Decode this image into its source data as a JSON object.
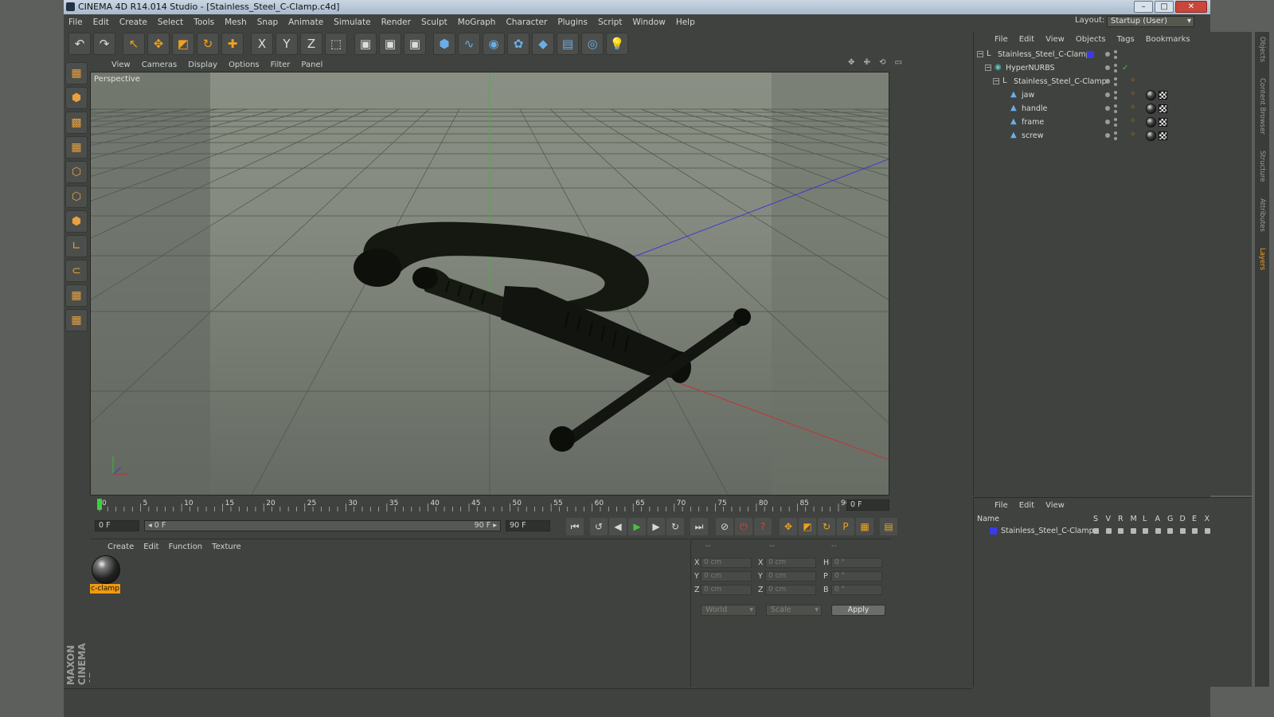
{
  "window": {
    "title": "CINEMA 4D R14.014 Studio - [Stainless_Steel_C-Clamp.c4d]",
    "min": "–",
    "max": "□",
    "close": "✕"
  },
  "menubar": [
    "File",
    "Edit",
    "Create",
    "Select",
    "Tools",
    "Mesh",
    "Snap",
    "Animate",
    "Simulate",
    "Render",
    "Sculpt",
    "MoGraph",
    "Character",
    "Plugins",
    "Script",
    "Window",
    "Help"
  ],
  "layout": {
    "label": "Layout:",
    "value": "Startup (User)"
  },
  "toolbar": [
    {
      "name": "undo-icon",
      "glyph": "↶"
    },
    {
      "name": "redo-icon",
      "glyph": "↷"
    },
    {
      "name": "live-select-icon",
      "glyph": "↖"
    },
    {
      "name": "move-icon",
      "glyph": "✥"
    },
    {
      "name": "scale-icon",
      "glyph": "◩"
    },
    {
      "name": "rotate-icon",
      "glyph": "↻"
    },
    {
      "name": "add-icon",
      "glyph": "✚"
    },
    {
      "name": "x-axis-icon",
      "glyph": "X"
    },
    {
      "name": "y-axis-icon",
      "glyph": "Y"
    },
    {
      "name": "z-axis-icon",
      "glyph": "Z"
    },
    {
      "name": "coordinate-system-icon",
      "glyph": "⬚"
    },
    {
      "name": "render-view-icon",
      "glyph": "▣"
    },
    {
      "name": "render-picture-viewer-icon",
      "glyph": "▣"
    },
    {
      "name": "render-settings-icon",
      "glyph": "▣"
    },
    {
      "name": "cube-icon",
      "glyph": "⬢"
    },
    {
      "name": "spline-icon",
      "glyph": "∿"
    },
    {
      "name": "nurbs-icon",
      "glyph": "◉"
    },
    {
      "name": "array-icon",
      "glyph": "✿"
    },
    {
      "name": "deformer-icon",
      "glyph": "◆"
    },
    {
      "name": "scene-floor-icon",
      "glyph": "▤"
    },
    {
      "name": "camera-icon",
      "glyph": "◎"
    },
    {
      "name": "light-icon",
      "glyph": "💡"
    }
  ],
  "lefttools": [
    {
      "name": "make-editable-icon",
      "glyph": "▦"
    },
    {
      "name": "model-mode-icon",
      "glyph": "⬢"
    },
    {
      "name": "texture-mode-icon",
      "glyph": "▩"
    },
    {
      "name": "workplane-mode-icon",
      "glyph": "▦"
    },
    {
      "name": "points-mode-icon",
      "glyph": "⬡"
    },
    {
      "name": "edges-mode-icon",
      "glyph": "⬡"
    },
    {
      "name": "polygons-mode-icon",
      "glyph": "⬢"
    },
    {
      "name": "axis-mode-icon",
      "glyph": "∟"
    },
    {
      "name": "snap-icon",
      "glyph": "⊂"
    },
    {
      "name": "workplane-icon",
      "glyph": "▦"
    },
    {
      "name": "locked-workplane-icon",
      "glyph": "▦"
    }
  ],
  "brand": "MAXON CINEMA 4D",
  "viewport": {
    "menu": [
      "View",
      "Cameras",
      "Display",
      "Options",
      "Filter",
      "Panel"
    ],
    "label": "Perspective",
    "icons": "✥ ✙ ⟲ ▭"
  },
  "timeline": {
    "ticks": [
      "0",
      "5",
      "10",
      "15",
      "20",
      "25",
      "30",
      "35",
      "40",
      "45",
      "50",
      "55",
      "60",
      "65",
      "70",
      "75",
      "80",
      "85",
      "90"
    ],
    "current_frame": "0 F"
  },
  "playbar": {
    "start": "0 F",
    "range_start": "◂ 0 F",
    "range_end": "90 F ▸",
    "end": "90 F",
    "buttons": [
      {
        "name": "go-to-start-icon",
        "glyph": "⏮",
        "cls": ""
      },
      {
        "name": "previous-key-icon",
        "glyph": "↺",
        "cls": ""
      },
      {
        "name": "previous-frame-icon",
        "glyph": "◀",
        "cls": ""
      },
      {
        "name": "play-forward-icon",
        "glyph": "▶",
        "cls": "green"
      },
      {
        "name": "next-frame-icon",
        "glyph": "▶",
        "cls": ""
      },
      {
        "name": "next-key-icon",
        "glyph": "↻",
        "cls": ""
      },
      {
        "name": "go-to-end-icon",
        "glyph": "⏭",
        "cls": ""
      },
      {
        "name": "record-active-objects-icon",
        "glyph": "⊘",
        "cls": ""
      },
      {
        "name": "autokeying-icon",
        "glyph": "⏻",
        "cls": "red"
      },
      {
        "name": "keyframe-selection-icon",
        "glyph": "?",
        "cls": "red"
      },
      {
        "name": "position-key-icon",
        "glyph": "✥",
        "cls": "org"
      },
      {
        "name": "scale-key-icon",
        "glyph": "◩",
        "cls": "org"
      },
      {
        "name": "rotation-key-icon",
        "glyph": "↻",
        "cls": "org"
      },
      {
        "name": "parameter-key-icon",
        "glyph": "P",
        "cls": "org"
      },
      {
        "name": "point-level-key-icon",
        "glyph": "▦",
        "cls": "org"
      },
      {
        "name": "timeline-window-icon",
        "glyph": "▤",
        "cls": "org"
      }
    ]
  },
  "material": {
    "menu": [
      "Create",
      "Edit",
      "Function",
      "Texture"
    ],
    "items": [
      {
        "name": "c-clamp"
      }
    ]
  },
  "coordinates": {
    "header": [
      "--",
      "--",
      "--"
    ],
    "rows": [
      {
        "a": "X",
        "av": "0 cm",
        "b": "X",
        "bv": "0 cm",
        "c": "H",
        "cv": "0 °"
      },
      {
        "a": "Y",
        "av": "0 cm",
        "b": "Y",
        "bv": "0 cm",
        "c": "P",
        "cv": "0 °"
      },
      {
        "a": "Z",
        "av": "0 cm",
        "b": "Z",
        "bv": "0 cm",
        "c": "B",
        "cv": "0 °"
      }
    ],
    "mode": "World",
    "scale": "Scale",
    "apply": "Apply"
  },
  "objects": {
    "menu": [
      "File",
      "Edit",
      "View",
      "Objects",
      "Tags",
      "Bookmarks"
    ],
    "tree": [
      {
        "name": "Stainless_Steel_C-Clamp",
        "depth": 0,
        "type": "null"
      },
      {
        "name": "HyperNURBS",
        "depth": 1,
        "type": "nurbs"
      },
      {
        "name": "Stainless_Steel_C-Clamp",
        "depth": 2,
        "type": "null"
      },
      {
        "name": "jaw",
        "depth": 3,
        "type": "poly"
      },
      {
        "name": "handle",
        "depth": 3,
        "type": "poly"
      },
      {
        "name": "frame",
        "depth": 3,
        "type": "poly"
      },
      {
        "name": "screw",
        "depth": 3,
        "type": "poly"
      }
    ],
    "layer_color": "#3a3ae8"
  },
  "layers": {
    "menu": [
      "File",
      "Edit",
      "View"
    ],
    "columns": [
      "Name",
      "S",
      "V",
      "R",
      "M",
      "L",
      "A",
      "G",
      "D",
      "E",
      "X"
    ],
    "rows": [
      {
        "name": "Stainless_Steel_C-Clamp"
      }
    ]
  },
  "right_tabs": [
    "Objects",
    "Content Browser",
    "Structure",
    "Attributes",
    "Layers"
  ],
  "colors": {
    "accent": "#f0a020",
    "axis_x": "#c83030",
    "axis_y": "#30c030",
    "axis_z": "#3a3ad0"
  }
}
